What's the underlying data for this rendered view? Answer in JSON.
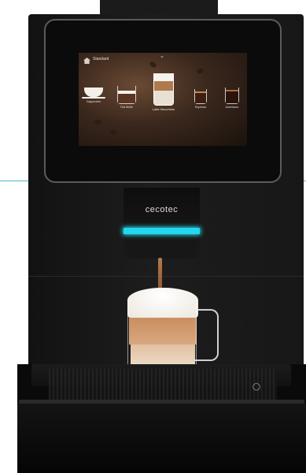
{
  "brand": {
    "logo_text": "cecotec"
  },
  "display": {
    "profile_label": "Standard",
    "nav_icon": "chevron-down-icon",
    "home_icon": "home-icon",
    "drinks": [
      {
        "label": "Cappuccino",
        "style": "cup"
      },
      {
        "label": "Flat White",
        "style": "glass"
      },
      {
        "label": "Latte Macchiato",
        "style": "tall",
        "selected": true
      },
      {
        "label": "Espresso",
        "style": "espresso"
      },
      {
        "label": "Americano",
        "style": "americano"
      }
    ]
  },
  "colors": {
    "led_accent": "#22d7ee",
    "machine_body": "#1a1a1a",
    "guide_line": "#4fb6c2"
  }
}
